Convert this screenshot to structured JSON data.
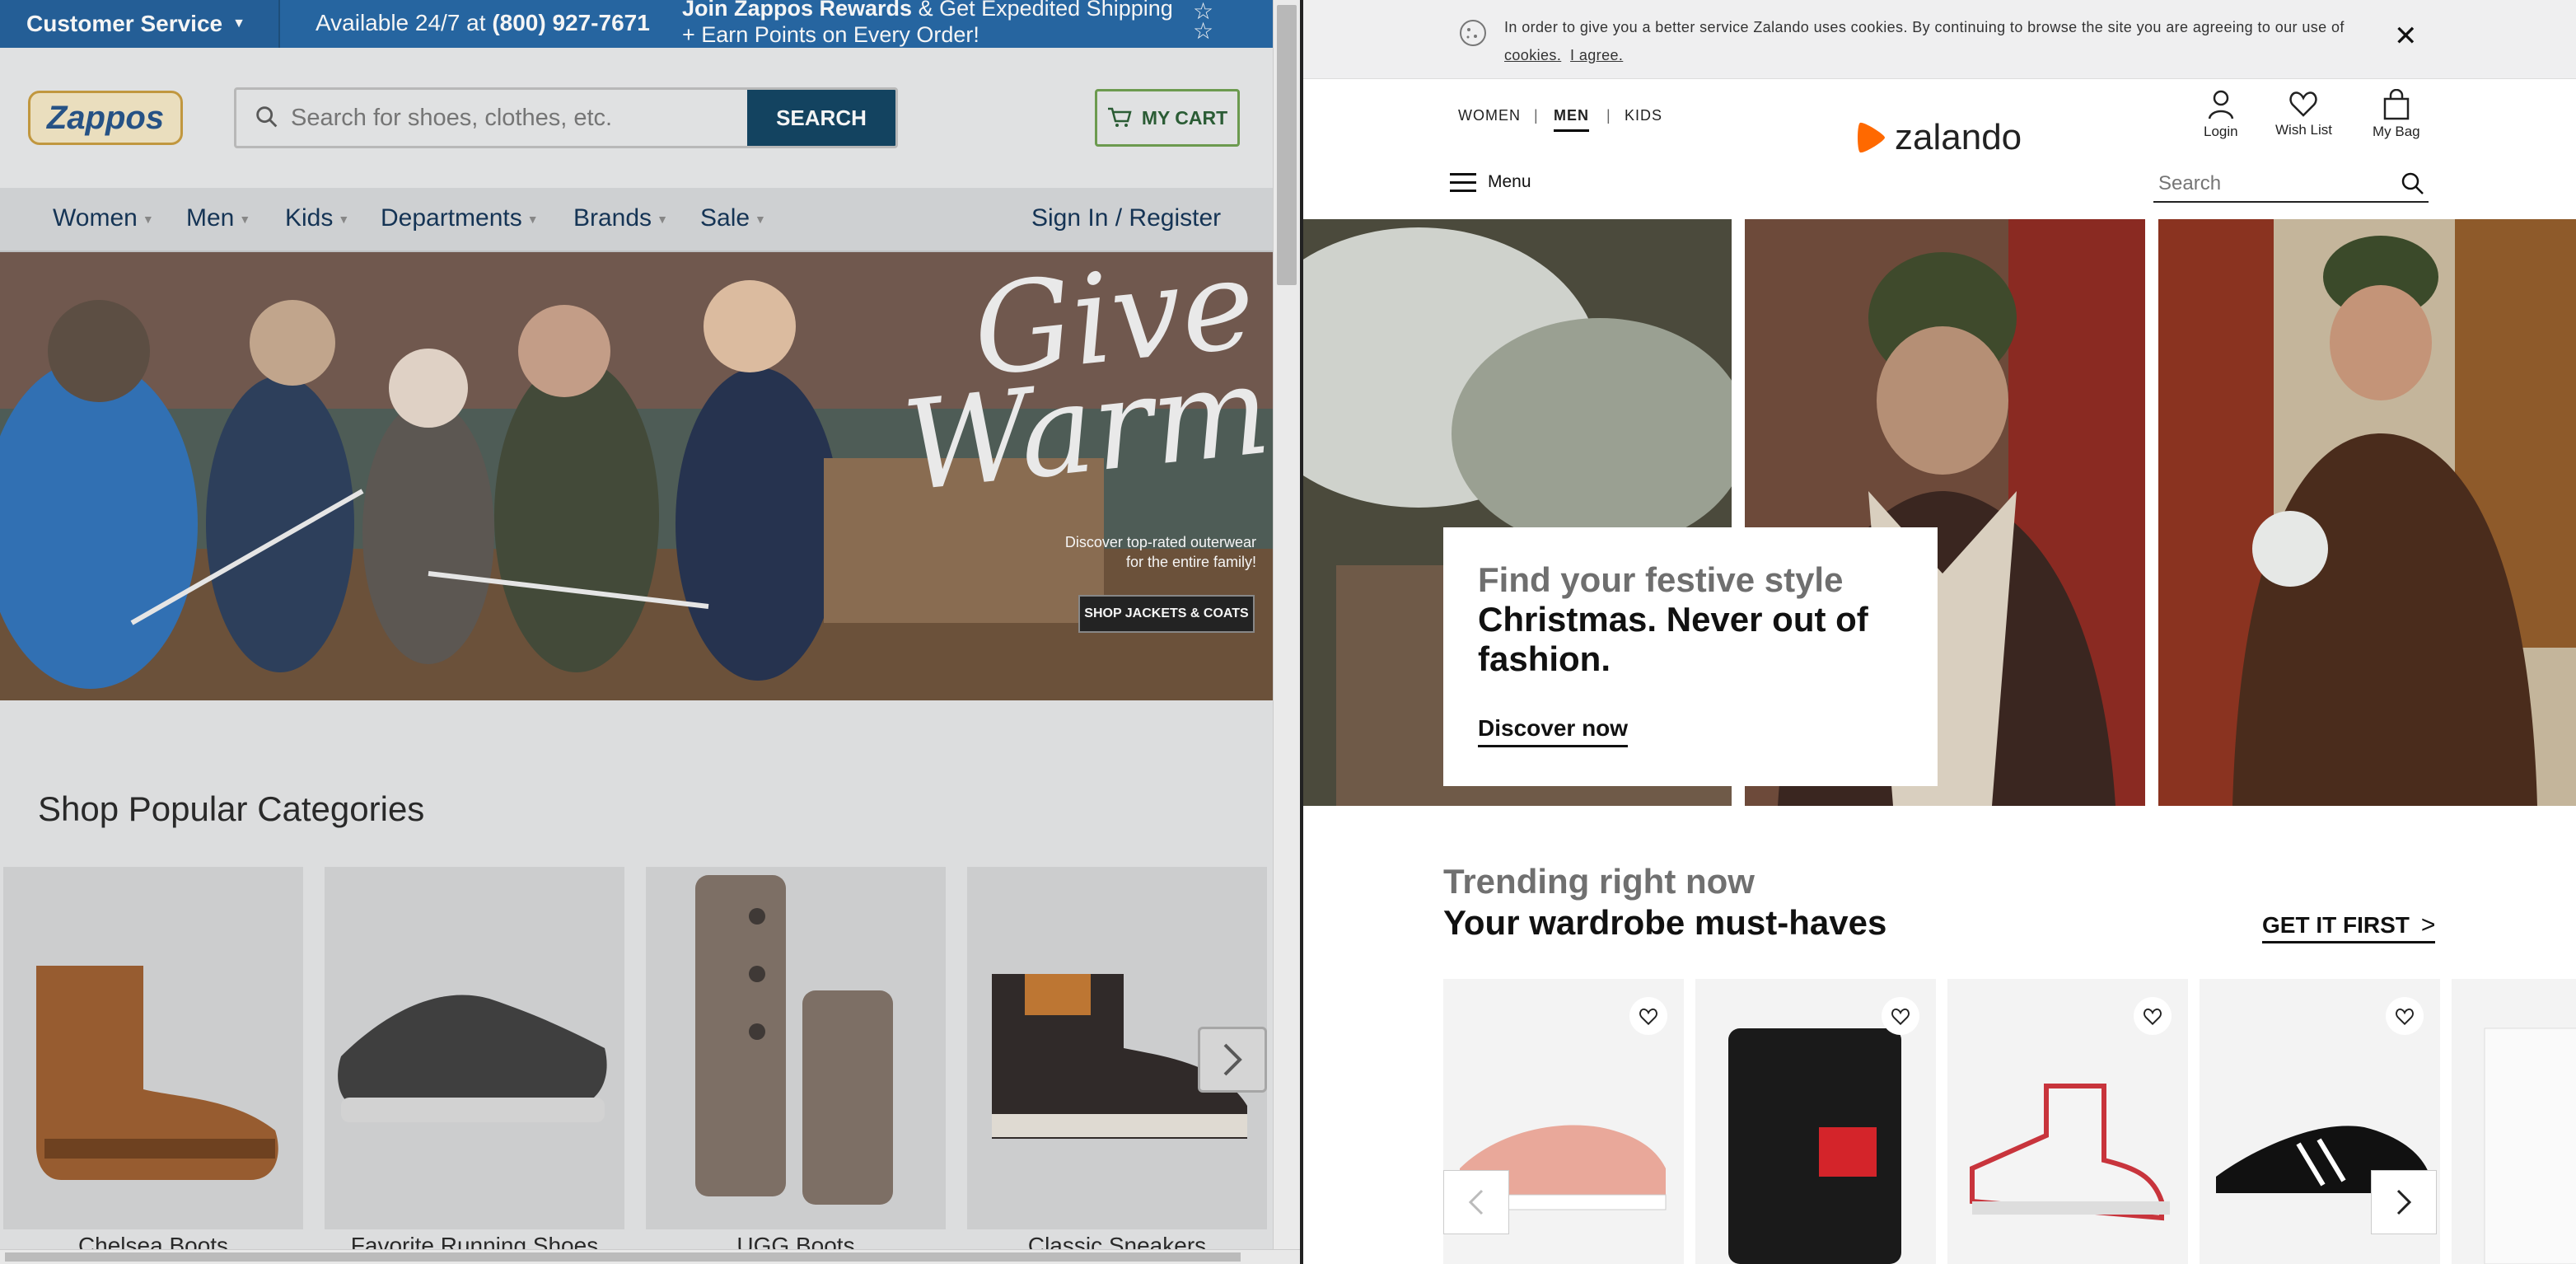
{
  "zappos": {
    "topbar": {
      "customer_service": "Customer Service",
      "availability_prefix": "Available 24/7 at ",
      "phone": "(800) 927-7671",
      "rewards_bold": "Join Zappos Rewards",
      "rewards_line1_rest": " & Get Expedited Shipping",
      "rewards_line2": "+ Earn Points on Every Order!"
    },
    "logo": "Zappos",
    "search": {
      "placeholder": "Search for shoes, clothes, etc.",
      "button": "SEARCH"
    },
    "cart_label": "MY CART",
    "nav": {
      "items": [
        "Women",
        "Men",
        "Kids",
        "Departments",
        "Brands",
        "Sale"
      ],
      "sign_in": "Sign In / Register"
    },
    "hero": {
      "headline": "Give Warmth",
      "copy_line1": "Discover top-rated outerwear",
      "copy_line2": "for the entire family!",
      "button": "SHOP JACKETS & COATS"
    },
    "categories": {
      "title": "Shop Popular Categories",
      "items": [
        "Chelsea Boots",
        "Favorite Running Shoes",
        "UGG Boots",
        "Classic Sneakers"
      ]
    }
  },
  "zalando": {
    "cookie": {
      "text": "In order to give you a better service Zalando uses cookies. By continuing to browse the site you are agreeing to our use of",
      "link_cookies": "cookies.",
      "link_agree": "I agree."
    },
    "gender_tabs": [
      "WOMEN",
      "MEN",
      "KIDS"
    ],
    "active_tab": "MEN",
    "logo": "zalando",
    "header_icons": [
      "Login",
      "Wish List",
      "My Bag"
    ],
    "menu_label": "Menu",
    "search_placeholder": "Search",
    "hero": {
      "line1": "Find your festive style",
      "line2": "Christmas. Never out of fashion.",
      "cta": "Discover now"
    },
    "trending": {
      "line1": "Trending right now",
      "line2": "Your wardrobe must-haves",
      "cta": "GET IT FIRST"
    },
    "colors": {
      "zappos_blue": "#1f63a3",
      "zappos_search_btn": "#0a3e5e",
      "zalando_orange": "#ff6900"
    }
  }
}
